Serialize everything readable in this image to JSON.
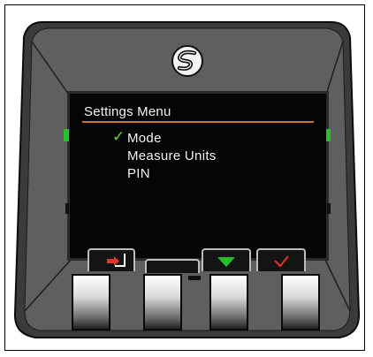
{
  "screen": {
    "menu_title": "Settings Menu",
    "items": [
      {
        "label": "Mode",
        "selected": true
      },
      {
        "label": "Measure Units",
        "selected": false
      },
      {
        "label": "PIN",
        "selected": false
      }
    ],
    "selected_icon": "checkmark-icon"
  },
  "softkeys": [
    {
      "icon": "enter-arrow-icon",
      "color": "#e8312a"
    },
    {
      "icon": "blank",
      "color": "#141414"
    },
    {
      "icon": "down-arrow-icon",
      "color": "#27c02a"
    },
    {
      "icon": "checkmark-icon",
      "color": "#e8312a"
    }
  ],
  "colors": {
    "bezel": "#5f5f5f",
    "outer_ring": "#3b3b3b",
    "screen": "#050505",
    "accent_rule": "#c87528",
    "led": "#27c02a"
  }
}
